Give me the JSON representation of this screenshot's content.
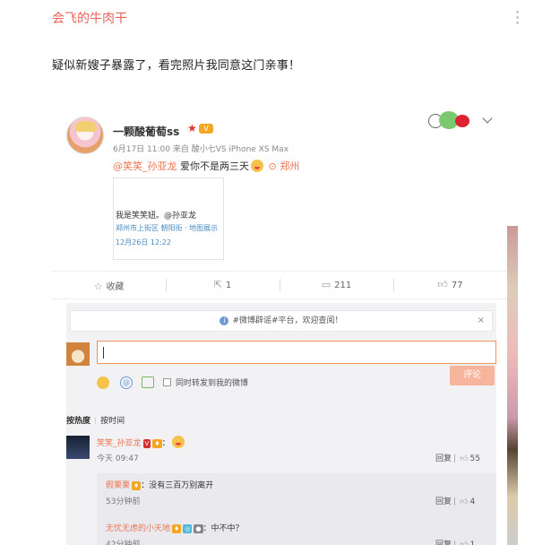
{
  "post": {
    "author": "会飞的牛肉干",
    "text": "疑似新嫂子暴露了，看完照片我同意这门亲事！"
  },
  "screenshot": {
    "weibo": {
      "nickname": "一颗酸葡萄ss",
      "meta": "6月17日 11:00 来自 酸小七VS iPhone XS Max",
      "mention": "@笑笑_孙亚龙",
      "text": "爱你不是两三天",
      "location": "郑州",
      "card": {
        "line1": "我是笑笑妞。@孙亚龙",
        "line2": "郑州市上街区 朝阳街 · 地图展示",
        "line3": "12月26日 12:22"
      },
      "actions": {
        "favorite": "收藏",
        "repost": "1",
        "comment": "211",
        "like": "77"
      }
    },
    "comments": {
      "notice": "#微博辟谣#平台，欢迎查阅！",
      "close": "×",
      "repost_checkbox_label": "同时转发到我的微博",
      "submit": "评论",
      "sort_hot": "按热度",
      "sort_time": "按时间",
      "items": [
        {
          "name": "笑笑_孙亚龙",
          "time": "今天 09:47",
          "reply": "回复",
          "likes": "55"
        }
      ],
      "replies": [
        {
          "name": "假栗栗",
          "text": "：没有三百万别离开",
          "time": "53分钟前",
          "reply": "回复",
          "likes": "4"
        },
        {
          "name": "无忧无虑的小天地",
          "text": "：中不中？",
          "time": "42分钟前",
          "reply": "回复",
          "likes": "1"
        }
      ]
    }
  },
  "icons": [
    "more-icon",
    "chevron-down-icon",
    "star-icon",
    "location-icon",
    "favorite-icon",
    "repost-icon",
    "comment-icon",
    "like-icon",
    "info-icon",
    "close-icon",
    "emoji-icon",
    "at-icon",
    "image-icon",
    "checkbox-icon"
  ],
  "colors": {
    "author": "#e8635a",
    "link": "#eb7350",
    "input_border": "#f3935b",
    "submit": "#f8b59d"
  }
}
